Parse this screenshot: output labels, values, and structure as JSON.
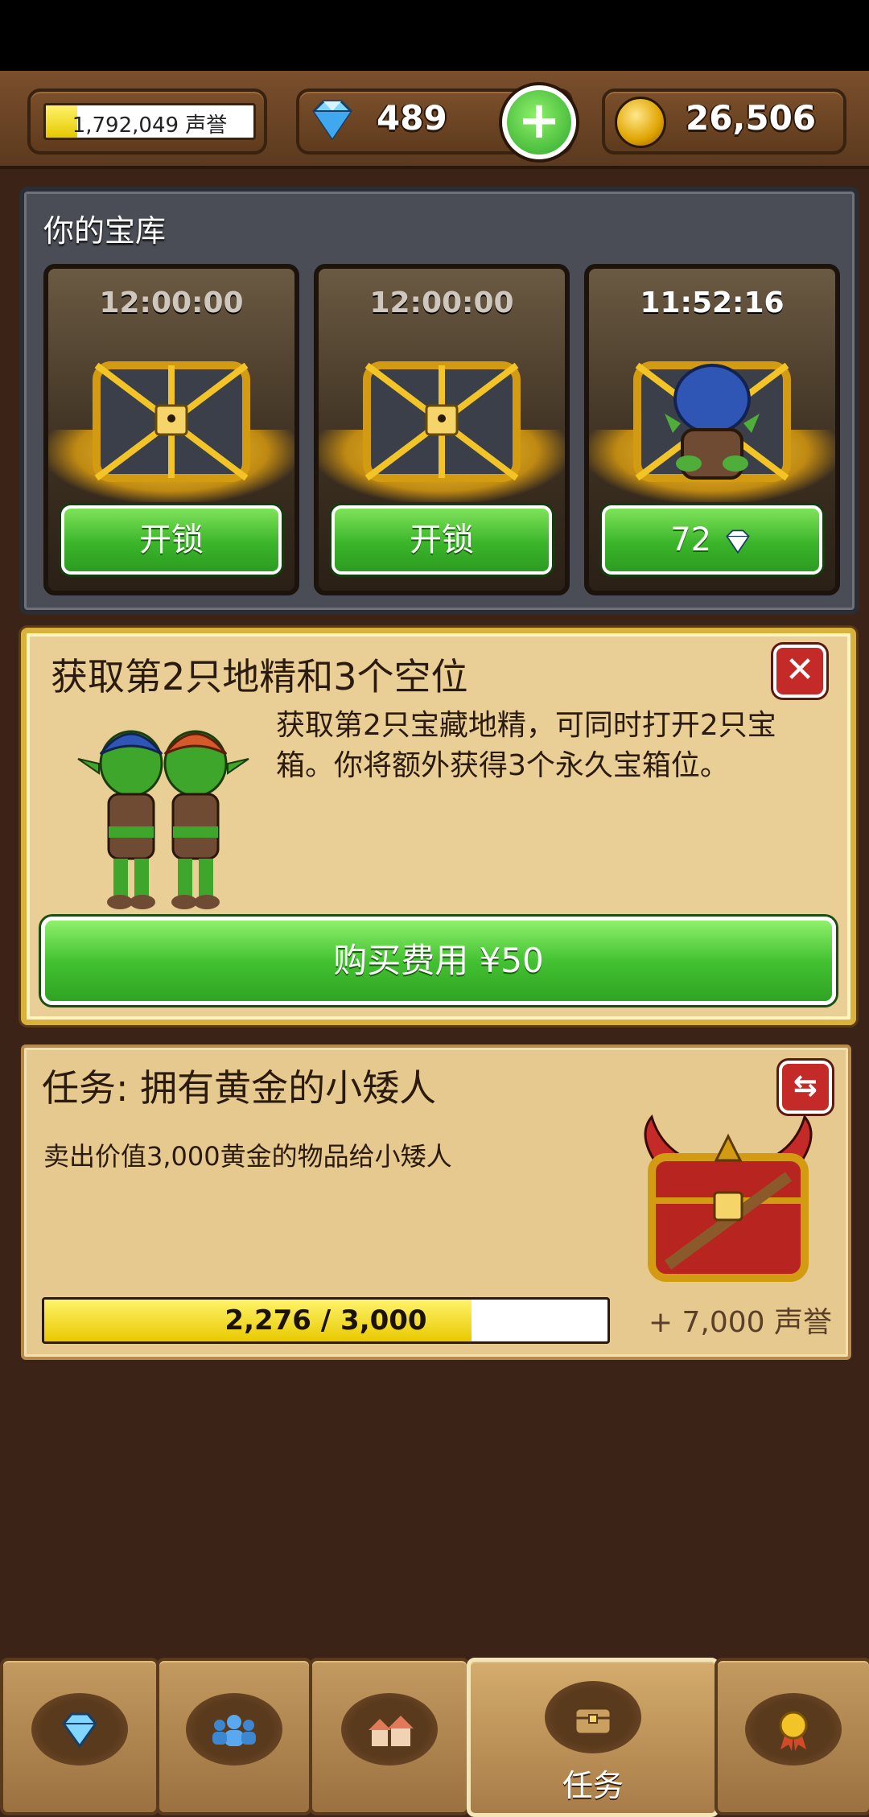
{
  "status_bar": {},
  "top_bar": {
    "reputation": {
      "text": "1,792,049 声誉",
      "progress": 0.15
    },
    "gems": {
      "value": "489",
      "plus_icon": "plus-icon",
      "icon": "diamond-icon"
    },
    "gold": {
      "value": "26,506",
      "icon": "coin-icon"
    }
  },
  "vault": {
    "title": "你的宝库",
    "slots": [
      {
        "timer": "12:00:00",
        "button_label": "开锁",
        "state": "locked"
      },
      {
        "timer": "12:00:00",
        "button_label": "开锁",
        "state": "locked"
      },
      {
        "timer": "11:52:16",
        "button_label": "72",
        "button_icon": "diamond-icon",
        "state": "unlocking"
      }
    ]
  },
  "offer": {
    "title": "获取第2只地精和3个空位",
    "description": "获取第2只宝藏地精，可同时打开2只宝箱。你将额外获得3个永久宝箱位。",
    "buy_label": "购买费用 ¥50",
    "close_icon": "close-icon"
  },
  "quest": {
    "title": "任务: 拥有黄金的小矮人",
    "description": "卖出价值3,000黄金的物品给小矮人",
    "progress_text": "2,276 / 3,000",
    "progress_current": 2276,
    "progress_total": 3000,
    "reward": "+ 7,000 声誉",
    "refresh_icon": "swap-icon"
  },
  "bottom_nav": {
    "tabs": [
      {
        "icon": "gems-icon",
        "label": ""
      },
      {
        "icon": "people-icon",
        "label": ""
      },
      {
        "icon": "houses-icon",
        "label": ""
      },
      {
        "icon": "chest-icon",
        "label": "任务",
        "active": true
      },
      {
        "icon": "medal-icon",
        "label": ""
      }
    ]
  },
  "colors": {
    "background": "#3b2417",
    "green_button": "#3bb52a",
    "gold_border": "#d8b23c",
    "progress_yellow": "#e8c900"
  }
}
